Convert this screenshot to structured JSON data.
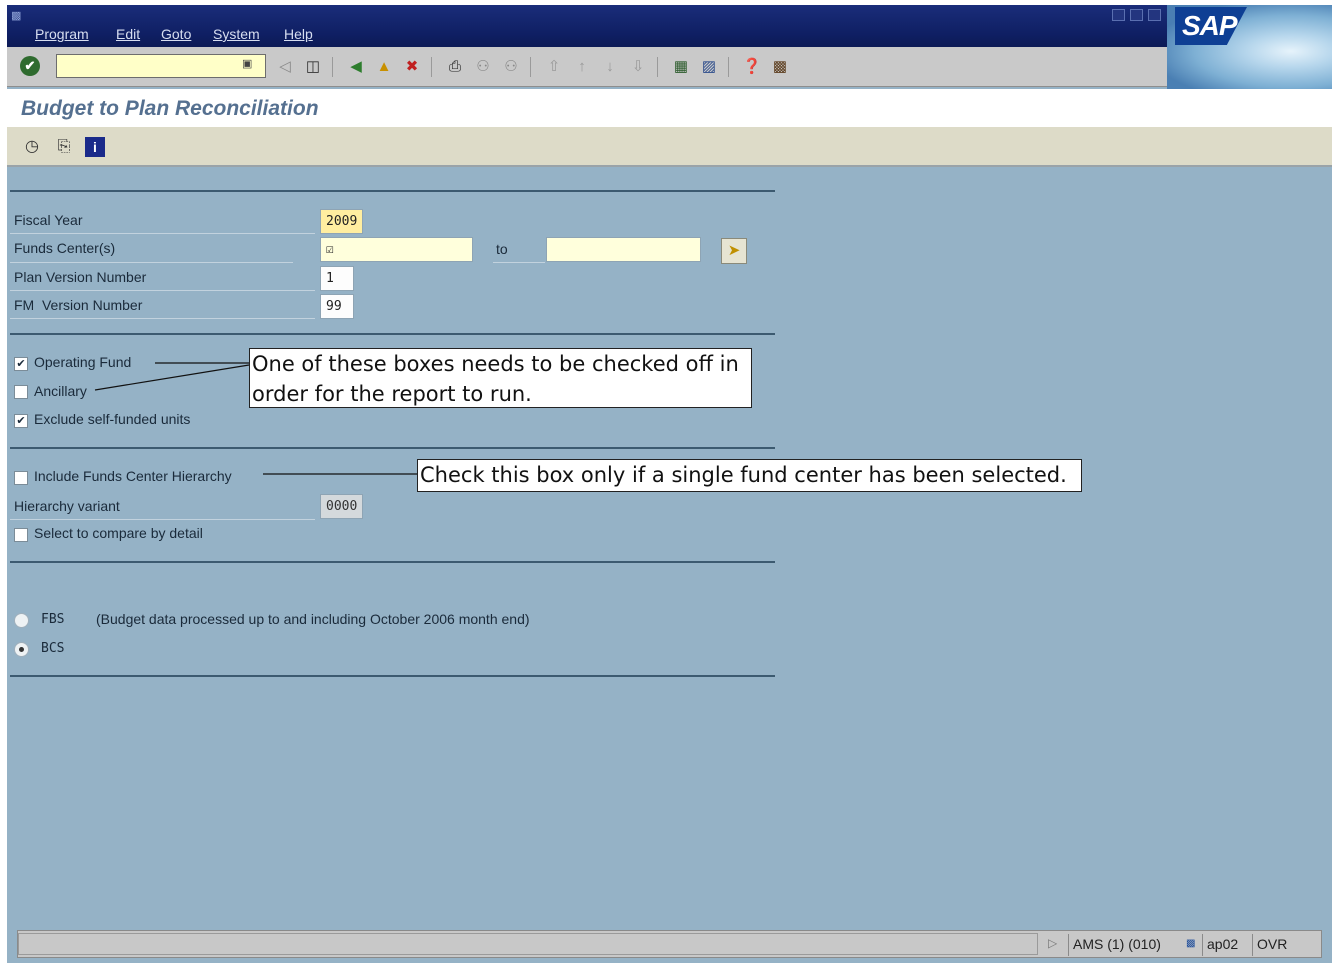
{
  "menu": {
    "items": [
      {
        "label": "Program"
      },
      {
        "label": "Edit"
      },
      {
        "label": "Goto"
      },
      {
        "label": "System"
      },
      {
        "label": "Help"
      }
    ],
    "brand": "SAP"
  },
  "toolbar": {
    "command_value": "",
    "icons": [
      "enter-icon",
      "save-icon",
      "back-icon",
      "exit-icon",
      "cancel-icon",
      "print-icon",
      "find-icon",
      "find-next-icon",
      "first-page-icon",
      "previous-page-icon",
      "next-page-icon",
      "last-page-icon",
      "create-session-icon",
      "shortcut-icon",
      "help-icon",
      "layout-icon"
    ]
  },
  "title": "Budget to Plan Reconciliation",
  "app_toolbar": {
    "icons": [
      "execute-icon",
      "get-variant-icon",
      "program-documentation-icon"
    ]
  },
  "form": {
    "fiscal_year": {
      "label": "Fiscal Year",
      "value": "2009"
    },
    "funds_center": {
      "label": "Funds Center(s)",
      "value_from": "☑",
      "to_label": "to",
      "value_to": ""
    },
    "plan_version": {
      "label": "Plan Version Number",
      "value": "1"
    },
    "fm_version": {
      "label": "FM  Version Number",
      "value": "99"
    },
    "operating_fund": {
      "label": "Operating Fund",
      "checked": true
    },
    "ancillary": {
      "label": "Ancillary",
      "checked": false
    },
    "exclude_self_funded": {
      "label": "Exclude self-funded units",
      "checked": true
    },
    "include_hierarchy": {
      "label": "Include Funds Center Hierarchy",
      "checked": false
    },
    "hierarchy_variant": {
      "label": "Hierarchy variant",
      "value": "0000"
    },
    "compare_by_detail": {
      "label": "Select to compare by detail",
      "checked": false
    },
    "radio_fbs": {
      "label": "FBS",
      "description": "(Budget data processed up to and including October 2006 month end)",
      "selected": false
    },
    "radio_bcs": {
      "label": "BCS",
      "selected": true
    }
  },
  "callouts": {
    "boxes_note": "One of these boxes needs to be checked off in order for the report to run.",
    "hierarchy_note": "Check this box only if a single fund center has been selected."
  },
  "status": {
    "system": "AMS (1) (010)",
    "server": "ap02",
    "mode": "OVR"
  }
}
